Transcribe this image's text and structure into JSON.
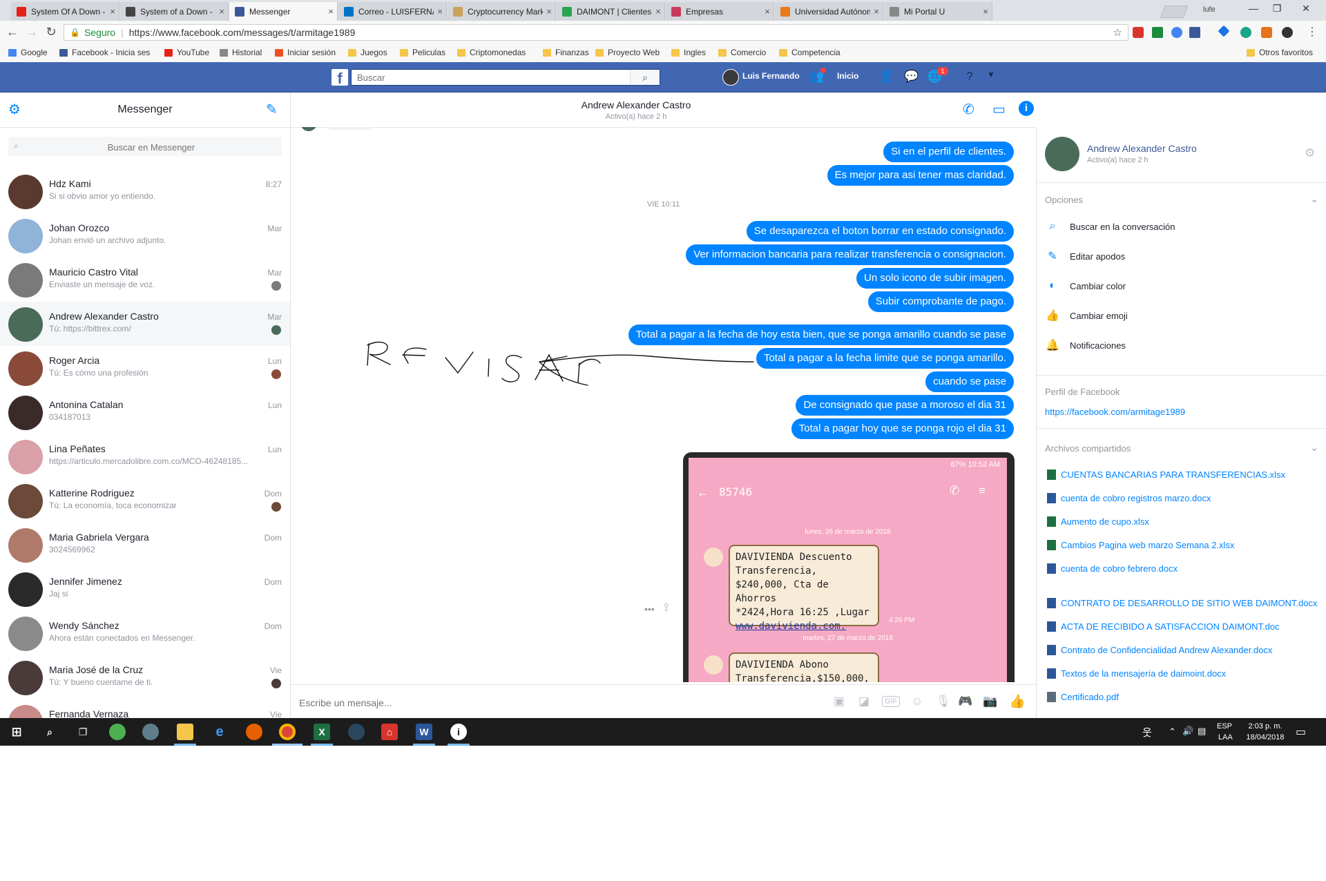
{
  "browser": {
    "tabs": [
      {
        "title": "System Of A Down - Ae",
        "icon": "youtube-icon",
        "color": "#e62117"
      },
      {
        "title": "System of a Down - B.Y",
        "icon": "power-icon",
        "color": "#444444"
      },
      {
        "title": "Messenger",
        "icon": "facebook-icon",
        "color": "#3b5998"
      },
      {
        "title": "Correo - LUISFERNAND",
        "icon": "outlook-icon",
        "color": "#0072c6"
      },
      {
        "title": "Cryptocurrency Market",
        "icon": "crypto-icon",
        "color": "#c9a35c"
      },
      {
        "title": "DAIMONT | Clientes",
        "icon": "daimont-icon",
        "color": "#2aa44f"
      },
      {
        "title": "Empresas",
        "icon": "empresas-icon",
        "color": "#c83c5a"
      },
      {
        "title": "Universidad Autónoma",
        "icon": "universidad-icon",
        "color": "#e87a1c"
      },
      {
        "title": "Mi Portal U",
        "icon": "page-icon",
        "color": "#888888"
      }
    ],
    "profile": "lufe",
    "secure_label": "Seguro",
    "url": "https://www.facebook.com/messages/t/armitage1989",
    "bookmarks": [
      {
        "label": "Google",
        "icon": "google-icon"
      },
      {
        "label": "Facebook - Inicia ses",
        "icon": "facebook-icon"
      },
      {
        "label": "YouTube",
        "icon": "youtube-icon"
      },
      {
        "label": "Historial",
        "icon": "history-icon"
      },
      {
        "label": "Iniciar sesión",
        "icon": "microsoft-icon"
      },
      {
        "label": "Juegos",
        "icon": "folder-icon"
      },
      {
        "label": "Peliculas",
        "icon": "folder-icon"
      },
      {
        "label": "Criptomonedas",
        "icon": "folder-icon"
      },
      {
        "label": "Finanzas",
        "icon": "folder-icon"
      },
      {
        "label": "Proyecto Web",
        "icon": "folder-icon"
      },
      {
        "label": "Ingles",
        "icon": "folder-icon"
      },
      {
        "label": "Comercio",
        "icon": "folder-icon"
      },
      {
        "label": "Competencia",
        "icon": "folder-icon"
      }
    ],
    "other_bookmarks": "Otros favoritos"
  },
  "fb": {
    "search_placeholder": "Buscar",
    "user": "Luis Fernando",
    "home": "Inicio",
    "notif_count": "1"
  },
  "left": {
    "title": "Messenger",
    "search_placeholder": "Buscar en Messenger",
    "conversations": [
      {
        "name": "Hdz Kami",
        "snippet": "Si si obvio amor yo entiendo.",
        "date": "8:27",
        "color": "#5a3a2e"
      },
      {
        "name": "Johan Orozco",
        "snippet": "Johan envió un archivo adjunto.",
        "date": "Mar",
        "color": "#8fb3d9"
      },
      {
        "name": "Mauricio Castro Vital",
        "snippet": "Enviaste un mensaje de voz.",
        "date": "Mar",
        "color": "#7a7a7a"
      },
      {
        "name": "Andrew Alexander Castro",
        "snippet": "Tú: https://bittrex.com/",
        "date": "Mar",
        "color": "#4b6b5a"
      },
      {
        "name": "Roger Arcia",
        "snippet": "Tú: Es cómo una profesión",
        "date": "Lun",
        "color": "#8a4a3a"
      },
      {
        "name": "Antonina Catalan",
        "snippet": "034187013",
        "date": "Lun",
        "color": "#3a2a2a"
      },
      {
        "name": "Lina Peñates",
        "snippet": "https://articulo.mercadolibre.com.co/MCO-46248185...",
        "date": "Lun",
        "color": "#d9a0a8"
      },
      {
        "name": "Katterine Rodriguez",
        "snippet": "Tú: La economía, toca economizar",
        "date": "Dom",
        "color": "#6b4a3a"
      },
      {
        "name": "Maria Gabriela Vergara",
        "snippet": "3024569962",
        "date": "Dom",
        "color": "#b07a6a"
      },
      {
        "name": "Jennifer Jimenez",
        "snippet": "Jaj si",
        "date": "Dom",
        "color": "#2a2a2a"
      },
      {
        "name": "Wendy Sánchez",
        "snippet": "Ahora están conectados en Messenger.",
        "date": "Dom",
        "color": "#8a8a8a"
      },
      {
        "name": "Maria José de la Cruz",
        "snippet": "Tú: Y bueno cuentame de ti.",
        "date": "Vie",
        "color": "#4a3a3a"
      },
      {
        "name": "Fernanda Vernaza",
        "snippet": "",
        "date": "Vie",
        "color": "#c98a8a"
      }
    ]
  },
  "chat": {
    "name": "Andrew Alexander Castro",
    "status": "Activo(a) hace 2 h",
    "messages_a": [
      "Si en el perfil de clientes.",
      "Es mejor para asi tener mas claridad."
    ],
    "timestamp": "VIE 10:11",
    "messages_b": [
      "Se desaparezca el boton borrar en estado consignado.",
      "Ver informacion bancaria para realizar transferencia o consignacion.",
      "Un solo icono de subir imagen.",
      "Subir comprobante de pago."
    ],
    "messages_c": [
      "Total a pagar a la fecha de hoy esta bien, que se ponga amarillo cuando se pase",
      "Total a pagar a la fecha limite que se ponga amarillo.",
      "cuando se pase",
      "De consignado que pase a moroso el dia 31",
      "Total a pagar hoy que se ponga rojo el dia 31"
    ],
    "annotation": "REVISAR",
    "phone": {
      "status": "87% 10:52 AM",
      "contact": "85746",
      "date1": "lunes, 26 de marzo de 2018",
      "sms1": [
        "DAVIVIENDA Descuento",
        "Transferencia,",
        "$240,000, Cta de Ahorros",
        "*2424,Hora 16:25 ,Lugar",
        "www.davivienda.com."
      ],
      "time1": "4:26 PM",
      "date2": "martes, 27 de marzo de 2018",
      "sms2": [
        "DAVIVIENDA Abono",
        "Transferencia,$150,000,"
      ]
    },
    "composer_placeholder": "Escribe un mensaje..."
  },
  "right": {
    "name": "Andrew Alexander Castro",
    "status": "Activo(a) hace 2 h",
    "options_title": "Opciones",
    "options": [
      {
        "label": "Buscar en la conversación",
        "icon": "search-icon",
        "glyph": "⌕"
      },
      {
        "label": "Editar apodos",
        "icon": "pencil-icon",
        "glyph": "✎"
      },
      {
        "label": "Cambiar color",
        "icon": "palette-icon",
        "glyph": "◐"
      },
      {
        "label": "Cambiar emoji",
        "icon": "thumbs-up-icon",
        "glyph": "👍"
      },
      {
        "label": "Notificaciones",
        "icon": "bell-icon",
        "glyph": "🔔"
      }
    ],
    "profile_title": "Perfil de Facebook",
    "profile_url": "https://facebook.com/armitage1989",
    "files_title": "Archivos compartidos",
    "files": [
      {
        "name": "CUENTAS BANCARIAS PARA TRANSFERENCIAS.xlsx",
        "kind": "xlsx"
      },
      {
        "name": "cuenta de cobro registros marzo.docx",
        "kind": "docx"
      },
      {
        "name": "Aumento de cupo.xlsx",
        "kind": "xlsx"
      },
      {
        "name": "Cambios Pagina web marzo Semana 2.xlsx",
        "kind": "xlsx"
      },
      {
        "name": "cuenta de cobro febrero.docx",
        "kind": "docx"
      },
      {
        "name": "CONTRATO DE DESARROLLO DE SITIO WEB DAIMONT.docx",
        "kind": "docx"
      },
      {
        "name": "ACTA DE RECIBIDO A SATISFACCION DAIMONT.doc",
        "kind": "docx"
      },
      {
        "name": "Contrato de Confidencialidad Andrew Alexander.docx",
        "kind": "docx"
      },
      {
        "name": "Textos de la mensajería de daimoint.docx",
        "kind": "docx"
      },
      {
        "name": "Certificado.pdf",
        "kind": "pdf"
      }
    ]
  },
  "taskbar": {
    "lang1": "ESP",
    "lang2": "LAA",
    "time": "2:03 p. m.",
    "date": "18/04/2018"
  }
}
